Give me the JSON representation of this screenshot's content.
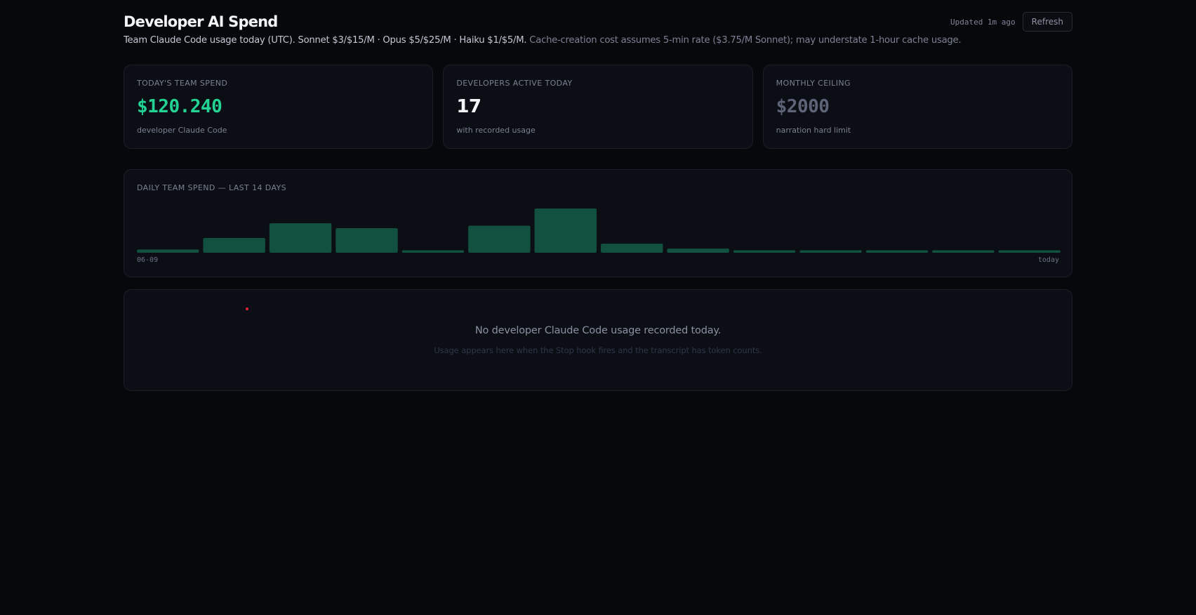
{
  "header": {
    "title": "Developer AI Spend",
    "subtitle_lead": "Team Claude Code usage today (UTC). Sonnet $3/$15/M · Opus $5/$25/M · Haiku $1/$5/M.",
    "subtitle_note": "Cache-creation cost assumes 5-min rate ($3.75/M Sonnet); may understate 1-hour cache usage.",
    "updated": "Updated 1m ago",
    "refresh_label": "Refresh"
  },
  "cards": [
    {
      "label": "TODAY'S TEAM SPEND",
      "value": "$120.240",
      "sub": "developer Claude Code"
    },
    {
      "label": "DEVELOPERS ACTIVE TODAY",
      "value": "17",
      "sub": "with recorded usage"
    },
    {
      "label": "MONTHLY CEILING",
      "value": "$2000",
      "sub": "narration hard limit"
    }
  ],
  "colors": {
    "accent_green": "#22d394",
    "bar_fill": "#12513f",
    "background": "#07080c"
  },
  "chart_data": {
    "type": "bar",
    "title": "DAILY TEAM SPEND — LAST 14 DAYS",
    "x_start_label": "06-09",
    "x_end_label": "today",
    "values": [
      4,
      18,
      36,
      30,
      3,
      33,
      54,
      11,
      5,
      3,
      3,
      3,
      3,
      3
    ],
    "ylim": [
      0,
      60
    ],
    "grid": false
  },
  "empty_state": {
    "message": "No developer Claude Code usage recorded today.",
    "hint": "Usage appears here when the Stop hook fires and the transcript has token counts."
  }
}
